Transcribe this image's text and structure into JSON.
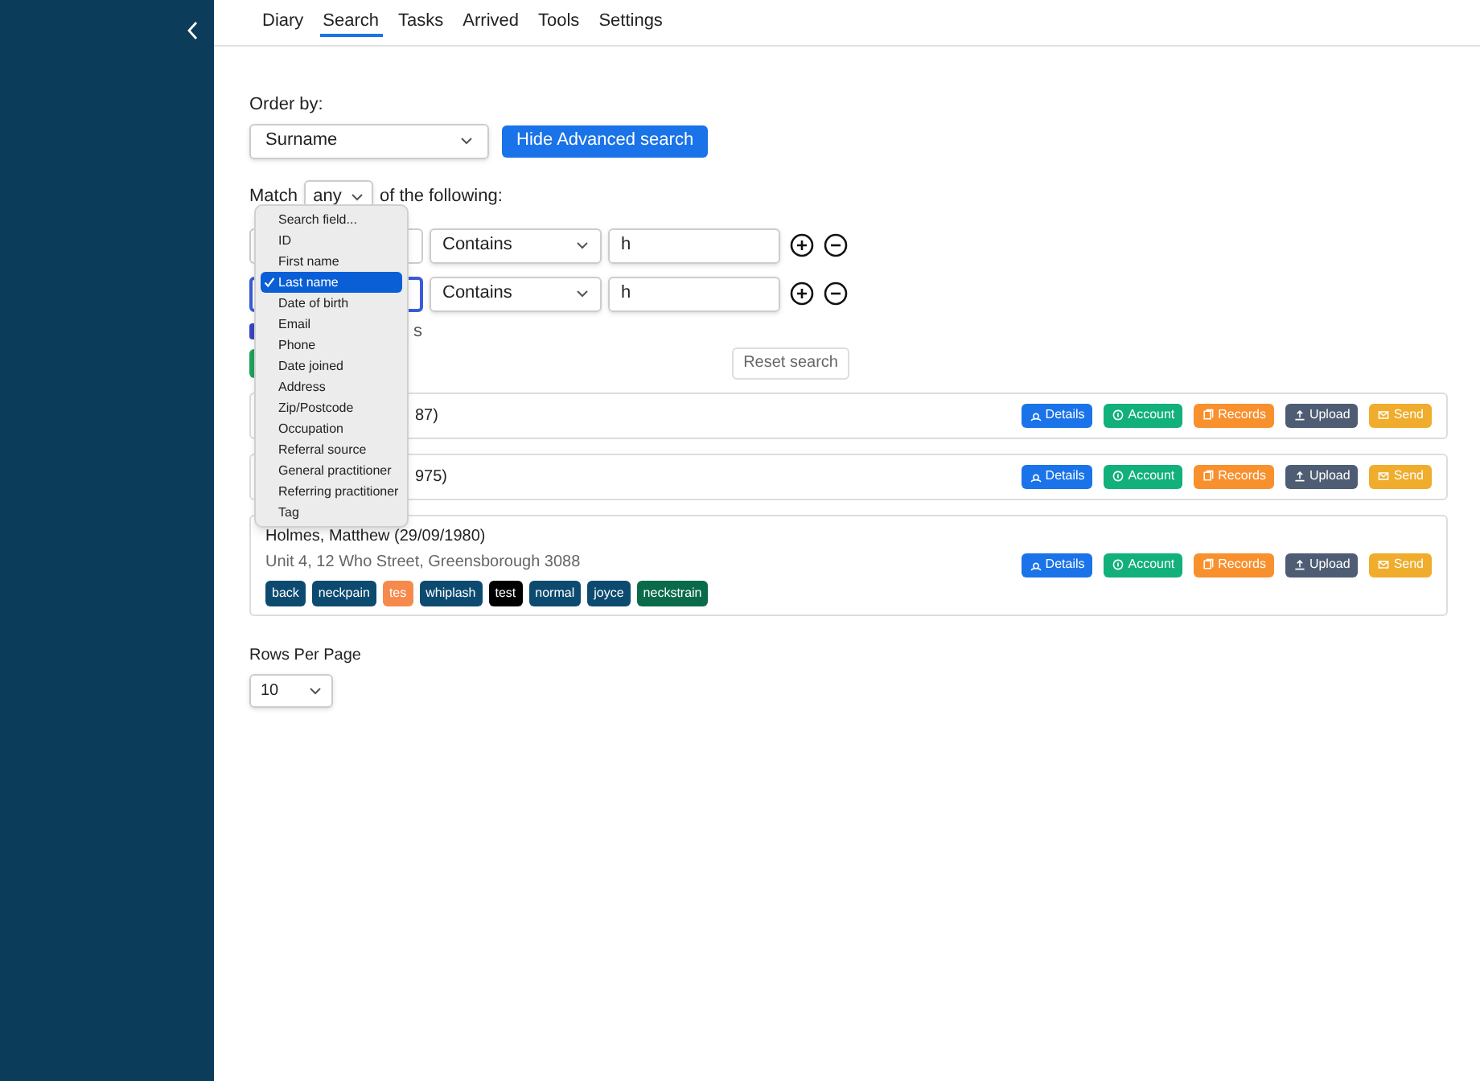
{
  "nav": [
    {
      "label": "Diary",
      "selected": false
    },
    {
      "label": "Search",
      "selected": true
    },
    {
      "label": "Tasks",
      "selected": false
    },
    {
      "label": "Arrived",
      "selected": false
    },
    {
      "label": "Tools",
      "selected": false
    },
    {
      "label": "Settings",
      "selected": false
    }
  ],
  "order_by": {
    "label": "Order by:",
    "value": "Surname"
  },
  "advanced_button": "Hide Advanced search",
  "match": {
    "prefix": "Match",
    "value": "any",
    "suffix": "of the following:"
  },
  "criteria": [
    {
      "operator": "Contains",
      "value": "h",
      "focused": false
    },
    {
      "operator": "Contains",
      "value": "h",
      "focused": true
    }
  ],
  "partial_checkbox": {
    "checked": true,
    "label": "s"
  },
  "reset_button": "Reset search",
  "field_menu": [
    {
      "label": "Search field...",
      "selected": false
    },
    {
      "label": "ID",
      "selected": false
    },
    {
      "label": "First name",
      "selected": false
    },
    {
      "label": "Last name",
      "selected": true
    },
    {
      "label": "Date of birth",
      "selected": false
    },
    {
      "label": "Email",
      "selected": false
    },
    {
      "label": "Phone",
      "selected": false
    },
    {
      "label": "Date joined",
      "selected": false
    },
    {
      "label": "Address",
      "selected": false
    },
    {
      "label": "Zip/Postcode",
      "selected": false
    },
    {
      "label": "Occupation",
      "selected": false
    },
    {
      "label": "Referral source",
      "selected": false
    },
    {
      "label": "General practitioner",
      "selected": false
    },
    {
      "label": "Referring practitioner",
      "selected": false
    },
    {
      "label": "Tag",
      "selected": false
    }
  ],
  "results": [
    {
      "name": "87)",
      "covered": true,
      "actions": [
        {
          "label": "Details",
          "kind": "details"
        },
        {
          "label": "Account",
          "kind": "account"
        },
        {
          "label": "Records",
          "kind": "records"
        },
        {
          "label": "Upload",
          "kind": "upload"
        },
        {
          "label": "Send",
          "kind": "send"
        }
      ]
    },
    {
      "name": "975)",
      "covered": true,
      "actions": [
        {
          "label": "Details",
          "kind": "details"
        },
        {
          "label": "Account",
          "kind": "account"
        },
        {
          "label": "Records",
          "kind": "records"
        },
        {
          "label": "Upload",
          "kind": "upload"
        },
        {
          "label": "Send",
          "kind": "send"
        }
      ]
    },
    {
      "name": "Holmes, Matthew  (29/09/1980)",
      "covered": false,
      "address": "Unit 4, 12 Who Street, Greensborough 3088",
      "tags": [
        {
          "label": "back",
          "color": "#0d4a70"
        },
        {
          "label": "neckpain",
          "color": "#0d4a70"
        },
        {
          "label": "tes",
          "color": "#f58a4b"
        },
        {
          "label": "whiplash",
          "color": "#0d4a70"
        },
        {
          "label": "test",
          "color": "#000000"
        },
        {
          "label": "normal",
          "color": "#0d4a70"
        },
        {
          "label": "joyce",
          "color": "#0d4a70"
        },
        {
          "label": "neckstrain",
          "color": "#0a6b4a"
        }
      ],
      "actions": [
        {
          "label": "Details",
          "kind": "details"
        },
        {
          "label": "Account",
          "kind": "account"
        },
        {
          "label": "Records",
          "kind": "records"
        },
        {
          "label": "Upload",
          "kind": "upload"
        },
        {
          "label": "Send",
          "kind": "send"
        }
      ]
    }
  ],
  "rows_per_page": {
    "label": "Rows Per Page",
    "value": "10"
  }
}
